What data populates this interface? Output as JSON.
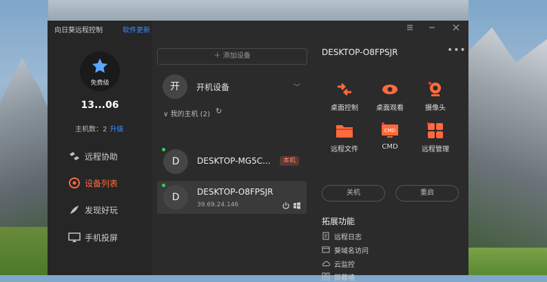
{
  "window": {
    "title": "向日葵远程控制",
    "update_link": "软件更新"
  },
  "profile": {
    "level": "免费级",
    "user_id": "13...06",
    "host_count_label": "主机数：2",
    "upgrade": "升级"
  },
  "nav": [
    {
      "label": "远程协助",
      "icon": "remote-assist-icon",
      "active": false
    },
    {
      "label": "设备列表",
      "icon": "device-list-icon",
      "active": true
    },
    {
      "label": "发现好玩",
      "icon": "discover-icon",
      "active": false
    },
    {
      "label": "手机投屏",
      "icon": "phone-cast-icon",
      "active": false
    }
  ],
  "devices_pane": {
    "add_device": "添加设备",
    "boot_device": {
      "avatar": "开",
      "label": "开机设备"
    },
    "my_hosts": "我的主机 (2)",
    "devices": [
      {
        "avatar": "D",
        "name": "DESKTOP-MG5C...",
        "badge": "本机",
        "ip": "",
        "online": true,
        "selected": false
      },
      {
        "avatar": "D",
        "name": "DESKTOP-O8FPSJR",
        "badge": "",
        "ip": "39.69.24.146",
        "online": true,
        "selected": true
      }
    ]
  },
  "detail": {
    "title": "DESKTOP-O8FPSJR",
    "actions": [
      {
        "label": "桌面控制",
        "icon": "desktop-control-icon"
      },
      {
        "label": "桌面观看",
        "icon": "desktop-view-icon"
      },
      {
        "label": "摄像头",
        "icon": "camera-icon"
      },
      {
        "label": "远程文件",
        "icon": "remote-file-icon"
      },
      {
        "label": "CMD",
        "icon": "cmd-icon",
        "icon_text": "CMD"
      },
      {
        "label": "远程管理",
        "icon": "remote-manage-icon"
      }
    ],
    "shutdown": "关机",
    "restart": "重启",
    "ext_title": "拓展功能",
    "ext_items": [
      {
        "label": "远程日志",
        "icon": "log-icon"
      },
      {
        "label": "葵域名访问",
        "icon": "domain-icon"
      },
      {
        "label": "云监控",
        "icon": "cloud-icon"
      },
      {
        "label": "屏幕墙",
        "icon": "screen-wall-icon"
      }
    ]
  },
  "colors": {
    "accent": "#ff6a3d",
    "link": "#3d8bff",
    "online": "#2fd35b",
    "panel": "#2b2b2b",
    "sidebar": "#262626"
  }
}
